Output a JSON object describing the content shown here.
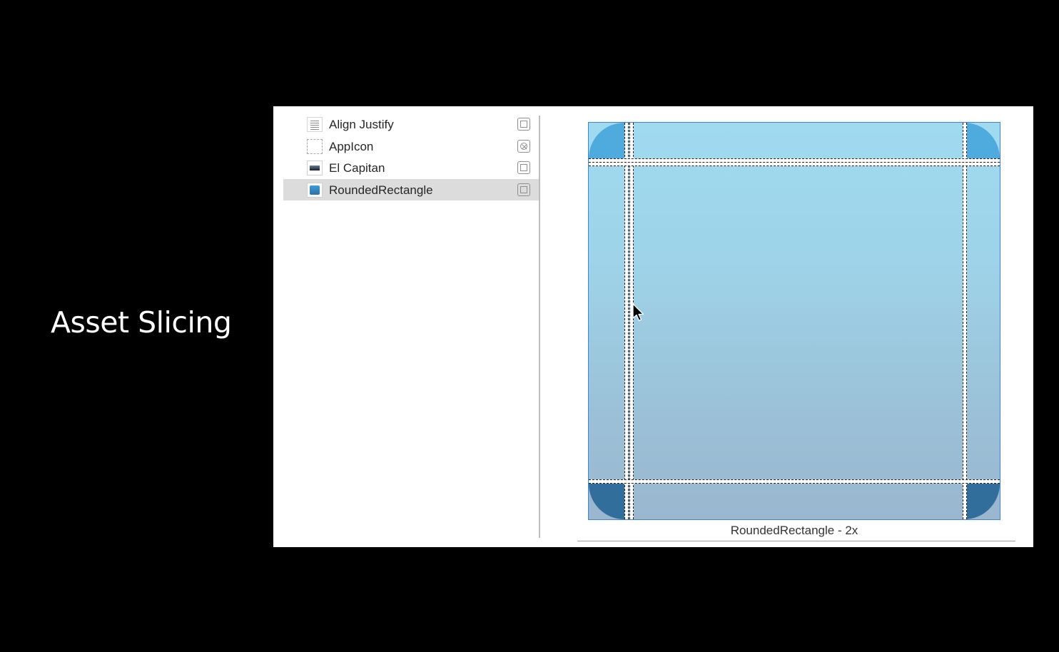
{
  "slide": {
    "title": "Asset Slicing"
  },
  "asset_catalog": {
    "items": [
      {
        "label": "Align Justify",
        "icon": "align-justify-icon",
        "selected": false
      },
      {
        "label": "AppIcon",
        "icon": "app-icon-placeholder-icon",
        "selected": false
      },
      {
        "label": "El Capitan",
        "icon": "landscape-image-icon",
        "selected": false
      },
      {
        "label": "RoundedRectangle",
        "icon": "rounded-rectangle-icon",
        "selected": true
      }
    ]
  },
  "slicing_editor": {
    "caption": "RoundedRectangle - 2x",
    "colors": {
      "border": "#3b84d6",
      "corner_top": "#4fabdd",
      "corner_bottom": "#316e9c",
      "fill_top": "#a0daf0",
      "fill_bottom": "#9ab7cf",
      "selection": "#dcdcdc"
    }
  }
}
